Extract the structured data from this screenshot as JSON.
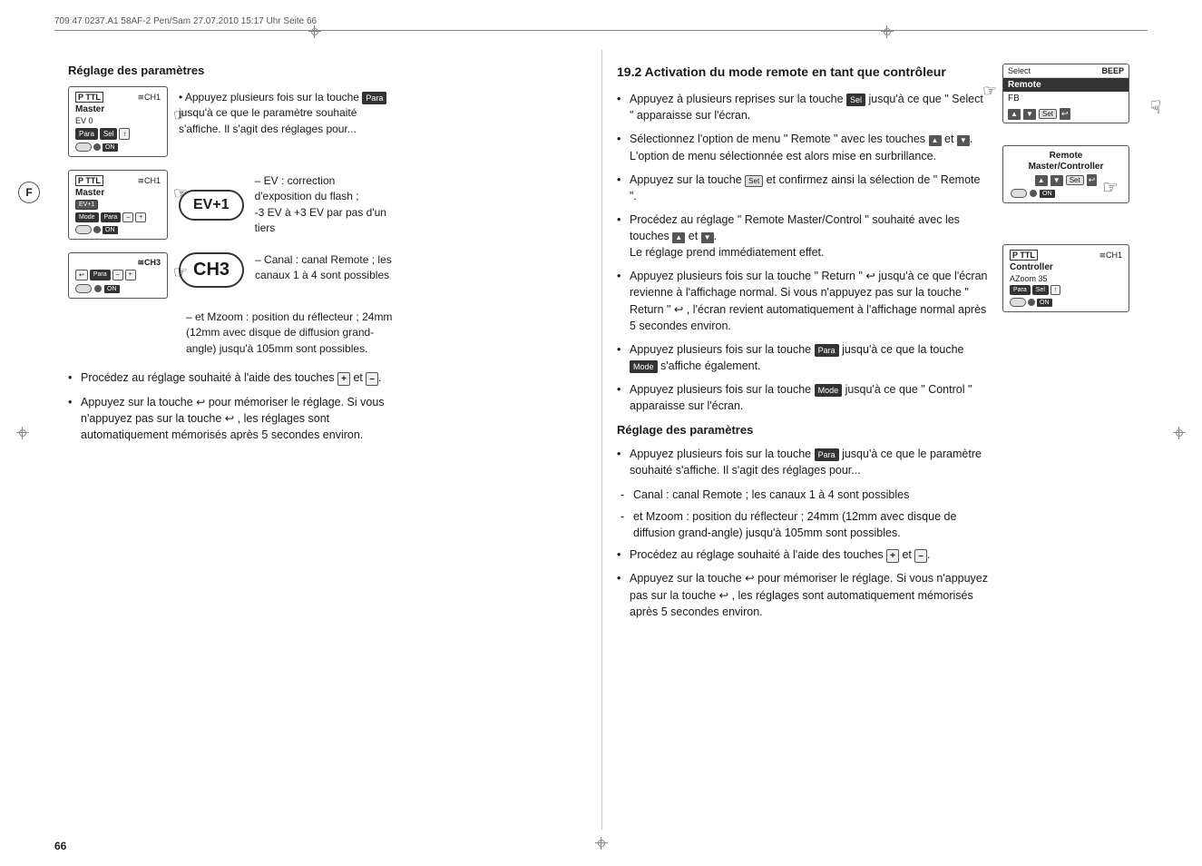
{
  "header": {
    "text": "709 47 0237.A1 58AF-2 Pen/Sam   27.07.2010   15:17 Uhr   Seite 66"
  },
  "page_number": "66",
  "left_section": {
    "heading": "Réglage des paramètres",
    "diagrams": [
      {
        "top_left": "P TTL",
        "top_right": "≅CH1",
        "label": "Master",
        "sub": "EV 0",
        "buttons": [
          "Para",
          "Sel",
          "↑"
        ]
      },
      {
        "top_left": "P TTL",
        "top_right": "≅CH1",
        "label": "Master",
        "sub": "EV+1",
        "buttons": [
          "Mode",
          "Para",
          "–",
          "+"
        ],
        "big_label": "EV+1",
        "desc_lines": [
          "– EV : correction d'exposition du flash ;",
          "-3 EV à +3 EV par pas d'un tiers"
        ]
      },
      {
        "top_right": "≅CH3",
        "big_label": "CH3",
        "buttons": [
          "↩",
          "Para",
          "–",
          "+"
        ],
        "desc_lines": [
          "– Canal : canal Remote ; les canaux 1 à 4 sont possibles"
        ],
        "desc2_lines": [
          "– et Mzoom : position du réflecteur ; 24mm (12mm avec disque de diffusion grand-angle) jusqu'à 105mm sont possibles."
        ]
      }
    ],
    "bottom_bullets": [
      "Procédez au réglage souhaité à l'aide des touches <b>+</b> et <b>–</b>.",
      "Appuyez sur la touche ↩ pour mémoriser le réglage. Si vous n'appuyez pas sur la touche ↩ , les réglages sont automatiquement mémorisés après 5 secondes environ."
    ]
  },
  "right_section": {
    "title": "19.2 Activation du mode remote en tant que contrôleur",
    "bullets": [
      "Appuyez à plusieurs reprises sur la touche Sel jusqu'à ce que \" Select \" apparaisse sur l'écran.",
      "Sélectionnez l'option de menu \" Remote \" avec les touches ▲ et ▼. L'option de menu sélectionnée est alors mise en surbrillance.",
      "Appuyez sur la touche Set et confirmez ainsi la sélection de \" Remote \".",
      "Procédez au réglage \" Remote Master/Control \" souhaité avec les touches ▲ et ▼. Le réglage prend immédiatement effet.",
      "Appuyez plusieurs fois sur la touche \" Return \" ↩ jusqu'à ce que l'écran revienne à l'affichage normal. Si vous n'appuyez pas sur la touche \" Return \" ↩ , l'écran revient automatiquement à l'affichage normal après 5 secondes environ.",
      "Appuyez plusieurs fois sur la touche Para jusqu'à ce que la touche Mode s'affiche également.",
      "Appuyez plusieurs fois sur la touche Mode jusqu'à ce que \" Control \" apparaisse sur l'écran."
    ],
    "reglage_heading": "Réglage des paramètres",
    "reglage_bullets": [
      "Appuyez plusieurs fois sur la touche Para jusqu'à ce que le paramètre souhaité s'affiche. Il s'agit des réglages pour..."
    ],
    "reglage_dashes": [
      "Canal : canal Remote ; les canaux 1 à 4 sont possibles",
      "et Mzoom : position du réflecteur ; 24mm (12mm avec disque de diffusion grand-angle) jusqu'à 105mm sont possibles."
    ],
    "reglage_bottom": [
      "Procédez au réglage souhaité à l'aide des touches + et –.",
      "Appuyez sur la touche ↩ pour mémoriser le réglage. Si vous n'appuyez pas sur la touche ↩ , les réglages sont automatiquement mémorisés après 5 secondes environ."
    ],
    "diagrams": {
      "select_beep": {
        "col1": "Select",
        "col2": "BEEP",
        "row2_highlighted": "Remote",
        "row3": "FB"
      },
      "remote_master": {
        "label1": "Remote",
        "label2": "Master/Controller"
      },
      "controller_box": {
        "top_left": "P TTL",
        "top_right": "≅CH1",
        "label": "Controller",
        "sub": "AZoom 35"
      }
    }
  }
}
